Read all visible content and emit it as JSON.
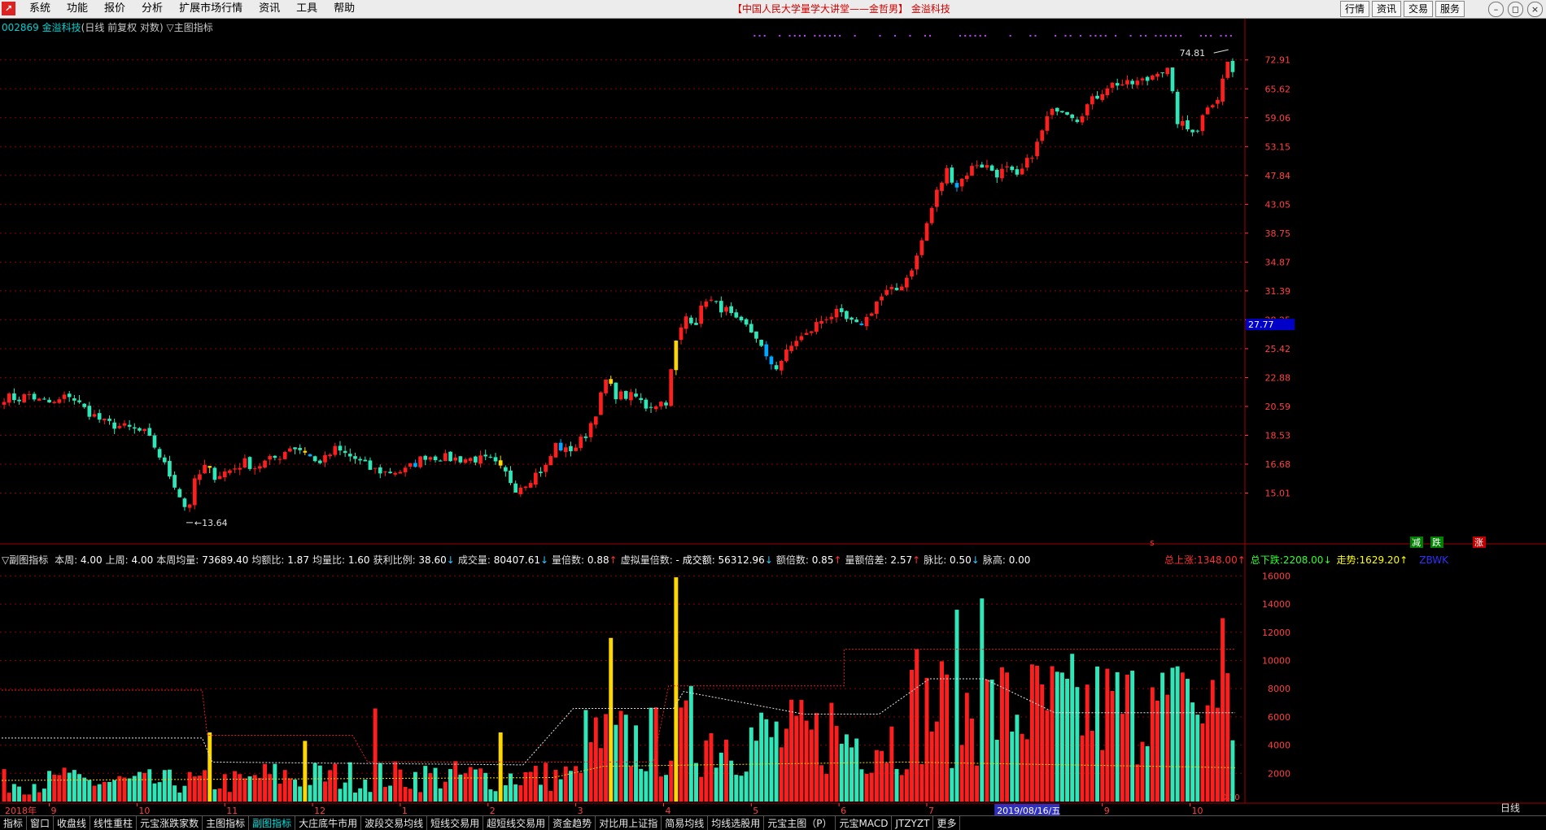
{
  "menubar": {
    "logo": "",
    "menus": [
      "系统",
      "功能",
      "报价",
      "分析",
      "扩展市场行情",
      "资讯",
      "工具",
      "帮助"
    ],
    "center_title": "【中国人民大学量学大讲堂——金哲男】 金溢科技",
    "right_buttons": [
      "行情",
      "资讯",
      "交易",
      "服务"
    ]
  },
  "main_header": {
    "code": "002869",
    "name": "金溢科技",
    "info": "(日线 前复权 对数) ▽主图指标"
  },
  "price_axis": {
    "labels": [
      "72.91",
      "65.62",
      "59.06",
      "53.15",
      "47.84",
      "43.05",
      "38.75",
      "34.87",
      "31.39",
      "28.25",
      "25.42",
      "22.88",
      "20.59",
      "18.53",
      "16.68",
      "15.01"
    ],
    "current_price": "27.77",
    "high_label": "74.81",
    "low_label": "13.64"
  },
  "sub_header": {
    "title": "▽副图指标",
    "items": [
      {
        "label": "本周:",
        "value": "4.00",
        "arrow": ""
      },
      {
        "label": "上周:",
        "value": "4.00",
        "arrow": ""
      },
      {
        "label": "本周均量:",
        "value": "73689.40",
        "arrow": ""
      },
      {
        "label": "均额比:",
        "value": "1.87",
        "arrow": ""
      },
      {
        "label": "均量比:",
        "value": "1.60",
        "arrow": ""
      },
      {
        "label": "获利比例:",
        "value": "38.60",
        "arrow": "↓"
      },
      {
        "label": "成交量:",
        "value": "80407.61",
        "arrow": "↓"
      },
      {
        "label": "量倍数:",
        "value": "0.88",
        "arrow": "↑"
      },
      {
        "label": "虚拟量倍数:",
        "value": "- 成交额: 56312.96",
        "arrow": "↓"
      },
      {
        "label": "额倍数:",
        "value": "0.85",
        "arrow": "↑"
      },
      {
        "label": "量额倍差:",
        "value": "2.57",
        "arrow": "↑"
      },
      {
        "label": "脉比:",
        "value": "0.50",
        "arrow": "↓"
      },
      {
        "label": "脉高:",
        "value": "0.00",
        "arrow": ""
      }
    ],
    "right": [
      {
        "label": "总上涨:",
        "value": "1348.00",
        "arrow": "↑",
        "color": "#ff3030"
      },
      {
        "label": "总下跌:",
        "value": "2208.00",
        "arrow": "↓",
        "color": "#30ff30"
      },
      {
        "label": "走势:",
        "value": "1629.20",
        "arrow": "↑",
        "color": "#ffff00"
      }
    ],
    "corner": "ZBWK"
  },
  "volume_axis": {
    "labels": [
      "16000",
      "14000",
      "12000",
      "10000",
      "8000",
      "6000",
      "4000",
      "2000"
    ],
    "unit": "X10"
  },
  "time_axis": {
    "labels": [
      "2018年",
      "9",
      "10",
      "11",
      "12",
      "1",
      "2",
      "3",
      "4",
      "5",
      "6",
      "7",
      "8",
      "9",
      "10"
    ],
    "cursor_date": "2019/08/16/五"
  },
  "markers": {
    "s": "s",
    "jian": "减",
    "die": "跌",
    "zhang": "涨"
  },
  "period_label": "日线",
  "tabs": [
    "指标",
    "窗口",
    "收盘线",
    "线性重柱",
    "元宝涨跌家数",
    "主图指标",
    "副图指标",
    "大庄底牛市用",
    "波段交易均线",
    "短线交易用",
    "超短线交易用",
    "资金趋势",
    "对比用上证指",
    "简易均线",
    "均线选股用",
    "元宝主图（P）",
    "元宝MACD",
    "JTZYZT",
    "更多"
  ],
  "active_tab": "副图指标",
  "chart_data": {
    "type": "candlestick+bar",
    "title": "002869 金溢科技",
    "price_scale": "log",
    "ylim_price": [
      13.64,
      74.81
    ],
    "ylim_volume": [
      0,
      16000
    ],
    "price_path": [
      [
        0,
        21.3
      ],
      [
        3,
        21.2
      ],
      [
        5,
        21.5
      ],
      [
        7,
        21.0
      ],
      [
        10,
        20.8
      ],
      [
        13,
        21.5
      ],
      [
        16,
        20.4
      ],
      [
        20,
        19.4
      ],
      [
        25,
        19.0
      ],
      [
        28,
        18.7
      ],
      [
        30,
        17.8
      ],
      [
        32,
        16.6
      ],
      [
        34,
        15.5
      ],
      [
        36,
        14.3
      ],
      [
        37,
        14.5
      ],
      [
        38,
        15.6
      ],
      [
        40,
        16.5
      ],
      [
        42,
        16.0
      ],
      [
        45,
        16.3
      ],
      [
        48,
        16.8
      ],
      [
        50,
        16.5
      ],
      [
        52,
        16.8
      ],
      [
        55,
        17.2
      ],
      [
        57,
        17.8
      ],
      [
        60,
        17.5
      ],
      [
        62,
        16.8
      ],
      [
        64,
        17.0
      ],
      [
        66,
        17.6
      ],
      [
        68,
        17.3
      ],
      [
        70,
        17.0
      ],
      [
        73,
        16.4
      ],
      [
        76,
        16.2
      ],
      [
        80,
        16.3
      ],
      [
        84,
        17.2
      ],
      [
        87,
        17.1
      ],
      [
        90,
        17.0
      ],
      [
        94,
        17.0
      ],
      [
        97,
        16.9
      ],
      [
        100,
        16.1
      ],
      [
        102,
        15.3
      ],
      [
        104,
        15.6
      ],
      [
        106,
        16.1
      ],
      [
        108,
        16.5
      ],
      [
        110,
        17.9
      ],
      [
        112,
        17.5
      ],
      [
        114,
        17.8
      ],
      [
        116,
        18.6
      ],
      [
        118,
        20.2
      ],
      [
        120,
        22.6
      ],
      [
        122,
        21.5
      ],
      [
        124,
        21.4
      ],
      [
        126,
        21.3
      ],
      [
        128,
        20.6
      ],
      [
        130,
        20.8
      ],
      [
        132,
        21.0
      ],
      [
        134,
        26.0
      ],
      [
        136,
        28.6
      ],
      [
        138,
        28.1
      ],
      [
        140,
        30.6
      ],
      [
        142,
        29.8
      ],
      [
        144,
        29.2
      ],
      [
        146,
        28.0
      ],
      [
        148,
        27.5
      ],
      [
        150,
        26.6
      ],
      [
        152,
        24.4
      ],
      [
        154,
        23.8
      ],
      [
        156,
        25.0
      ],
      [
        158,
        26.3
      ],
      [
        160,
        26.7
      ],
      [
        162,
        27.8
      ],
      [
        164,
        28.6
      ],
      [
        166,
        28.9
      ],
      [
        168,
        28.2
      ],
      [
        170,
        27.6
      ],
      [
        172,
        28.4
      ],
      [
        174,
        30.2
      ],
      [
        176,
        31.2
      ],
      [
        178,
        31.5
      ],
      [
        180,
        33.0
      ],
      [
        182,
        35.5
      ],
      [
        184,
        40.1
      ],
      [
        186,
        45.0
      ],
      [
        188,
        48.7
      ],
      [
        190,
        46.1
      ],
      [
        192,
        48.3
      ],
      [
        194,
        50.0
      ],
      [
        196,
        49.4
      ],
      [
        198,
        48.2
      ],
      [
        200,
        48.9
      ],
      [
        202,
        47.3
      ],
      [
        204,
        50.2
      ],
      [
        206,
        53.6
      ],
      [
        208,
        58.9
      ],
      [
        210,
        61.4
      ],
      [
        212,
        60.6
      ],
      [
        214,
        59.0
      ],
      [
        216,
        61.8
      ],
      [
        218,
        64.0
      ],
      [
        220,
        66.4
      ],
      [
        222,
        67.0
      ],
      [
        224,
        66.6
      ],
      [
        226,
        67.2
      ],
      [
        228,
        67.8
      ],
      [
        230,
        70.4
      ],
      [
        232,
        70.1
      ],
      [
        234,
        58.4
      ],
      [
        236,
        56.6
      ],
      [
        238,
        56.9
      ],
      [
        240,
        62.0
      ],
      [
        242,
        63.5
      ],
      [
        244,
        72.3
      ],
      [
        245,
        69.8
      ]
    ],
    "n_candles": 246,
    "volume_bars_note": "per-candle volume in X10 units, ~1000-15000; peaks ~11500 (Jan-2019), ~15800 (Apr-2019), ~14400 (Jul-2019), ~13000 (latest)"
  },
  "colors": {
    "up": "#ff1e1e",
    "down": "#2ee6b8",
    "down_dark": "#00a8ff",
    "special": "#ffd700",
    "grid": "#8b0000",
    "axis_text": "#ff4040",
    "background": "#000000",
    "current_price_bg": "#0000c8"
  }
}
